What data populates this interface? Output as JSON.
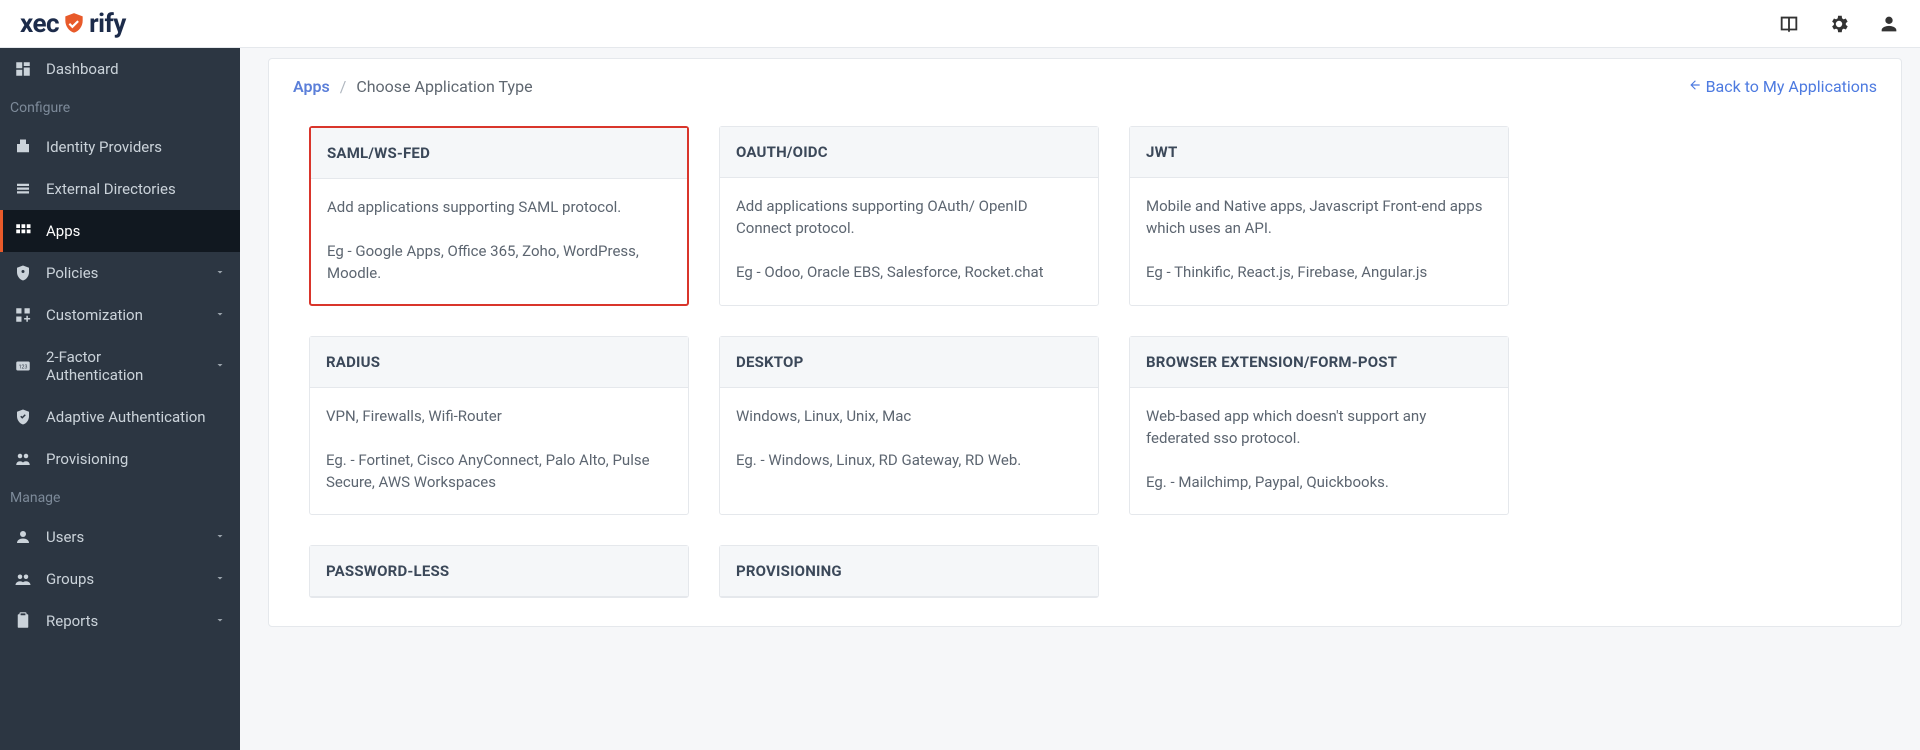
{
  "header": {
    "logo_pre": "xec",
    "logo_post": "rify"
  },
  "sidebar": {
    "items": [
      {
        "label": "Dashboard"
      }
    ],
    "section1": "Configure",
    "configure": [
      {
        "label": "Identity Providers"
      },
      {
        "label": "External Directories"
      },
      {
        "label": "Apps"
      },
      {
        "label": "Policies"
      },
      {
        "label": "Customization"
      },
      {
        "label": "2-Factor Authentication"
      },
      {
        "label": "Adaptive Authentication"
      },
      {
        "label": "Provisioning"
      }
    ],
    "section2": "Manage",
    "manage": [
      {
        "label": "Users"
      },
      {
        "label": "Groups"
      },
      {
        "label": "Reports"
      }
    ]
  },
  "breadcrumb": {
    "root": "Apps",
    "sep": "/",
    "current": "Choose Application Type",
    "back": "Back to My Applications"
  },
  "cards": [
    {
      "title": "SAML/WS-FED",
      "desc": "Add applications supporting SAML protocol.",
      "eg": "Eg - Google Apps, Office 365, Zoho, WordPress, Moodle.",
      "highlight": true
    },
    {
      "title": "OAUTH/OIDC",
      "desc": "Add applications supporting OAuth/ OpenID Connect protocol.",
      "eg": "Eg - Odoo, Oracle EBS, Salesforce, Rocket.chat"
    },
    {
      "title": "JWT",
      "desc": "Mobile and Native apps, Javascript Front-end apps which uses an API.",
      "eg": "Eg - Thinkific, React.js, Firebase, Angular.js"
    },
    {
      "title": "RADIUS",
      "desc": "VPN, Firewalls, Wifi-Router",
      "eg": "Eg. - Fortinet, Cisco AnyConnect, Palo Alto, Pulse Secure, AWS Workspaces"
    },
    {
      "title": "DESKTOP",
      "desc": "Windows, Linux, Unix, Mac",
      "eg": "Eg. - Windows, Linux, RD Gateway, RD Web."
    },
    {
      "title": "BROWSER EXTENSION/FORM-POST",
      "desc": "Web-based app which doesn't support any federated sso protocol.",
      "eg": "Eg. - Mailchimp, Paypal, Quickbooks."
    },
    {
      "title": "PASSWORD-LESS",
      "desc": "",
      "eg": ""
    },
    {
      "title": "PROVISIONING",
      "desc": "",
      "eg": ""
    }
  ]
}
